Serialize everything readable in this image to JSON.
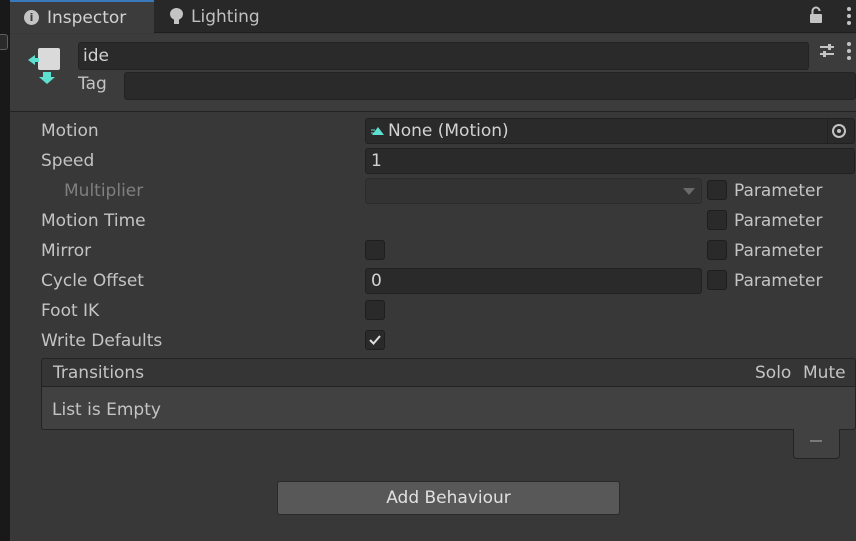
{
  "tabs": [
    {
      "label": "Inspector",
      "icon": "info-icon",
      "active": true
    },
    {
      "label": "Lighting",
      "icon": "lightbulb-icon",
      "active": false
    }
  ],
  "header": {
    "name_value": "ide",
    "tag_label": "Tag",
    "tag_value": ""
  },
  "properties": {
    "motion": {
      "label": "Motion",
      "value": "None (Motion)"
    },
    "speed": {
      "label": "Speed",
      "value": "1"
    },
    "multiplier": {
      "label": "Multiplier",
      "param_label": "Parameter"
    },
    "motion_time": {
      "label": "Motion Time",
      "param_label": "Parameter"
    },
    "mirror": {
      "label": "Mirror",
      "checked": false,
      "param_label": "Parameter"
    },
    "cycle_offset": {
      "label": "Cycle Offset",
      "value": "0",
      "param_label": "Parameter"
    },
    "foot_ik": {
      "label": "Foot IK",
      "checked": false
    },
    "write_defaults": {
      "label": "Write Defaults",
      "checked": true
    }
  },
  "transitions": {
    "header": "Transitions",
    "solo_label": "Solo",
    "mute_label": "Mute",
    "empty_text": "List is Empty",
    "remove_symbol": "–"
  },
  "add_behaviour_label": "Add Behaviour",
  "colors": {
    "accent_tab": "#3a79bb",
    "motion_icon": "#5ee0d0",
    "state_icon": "#5ee0d0"
  }
}
